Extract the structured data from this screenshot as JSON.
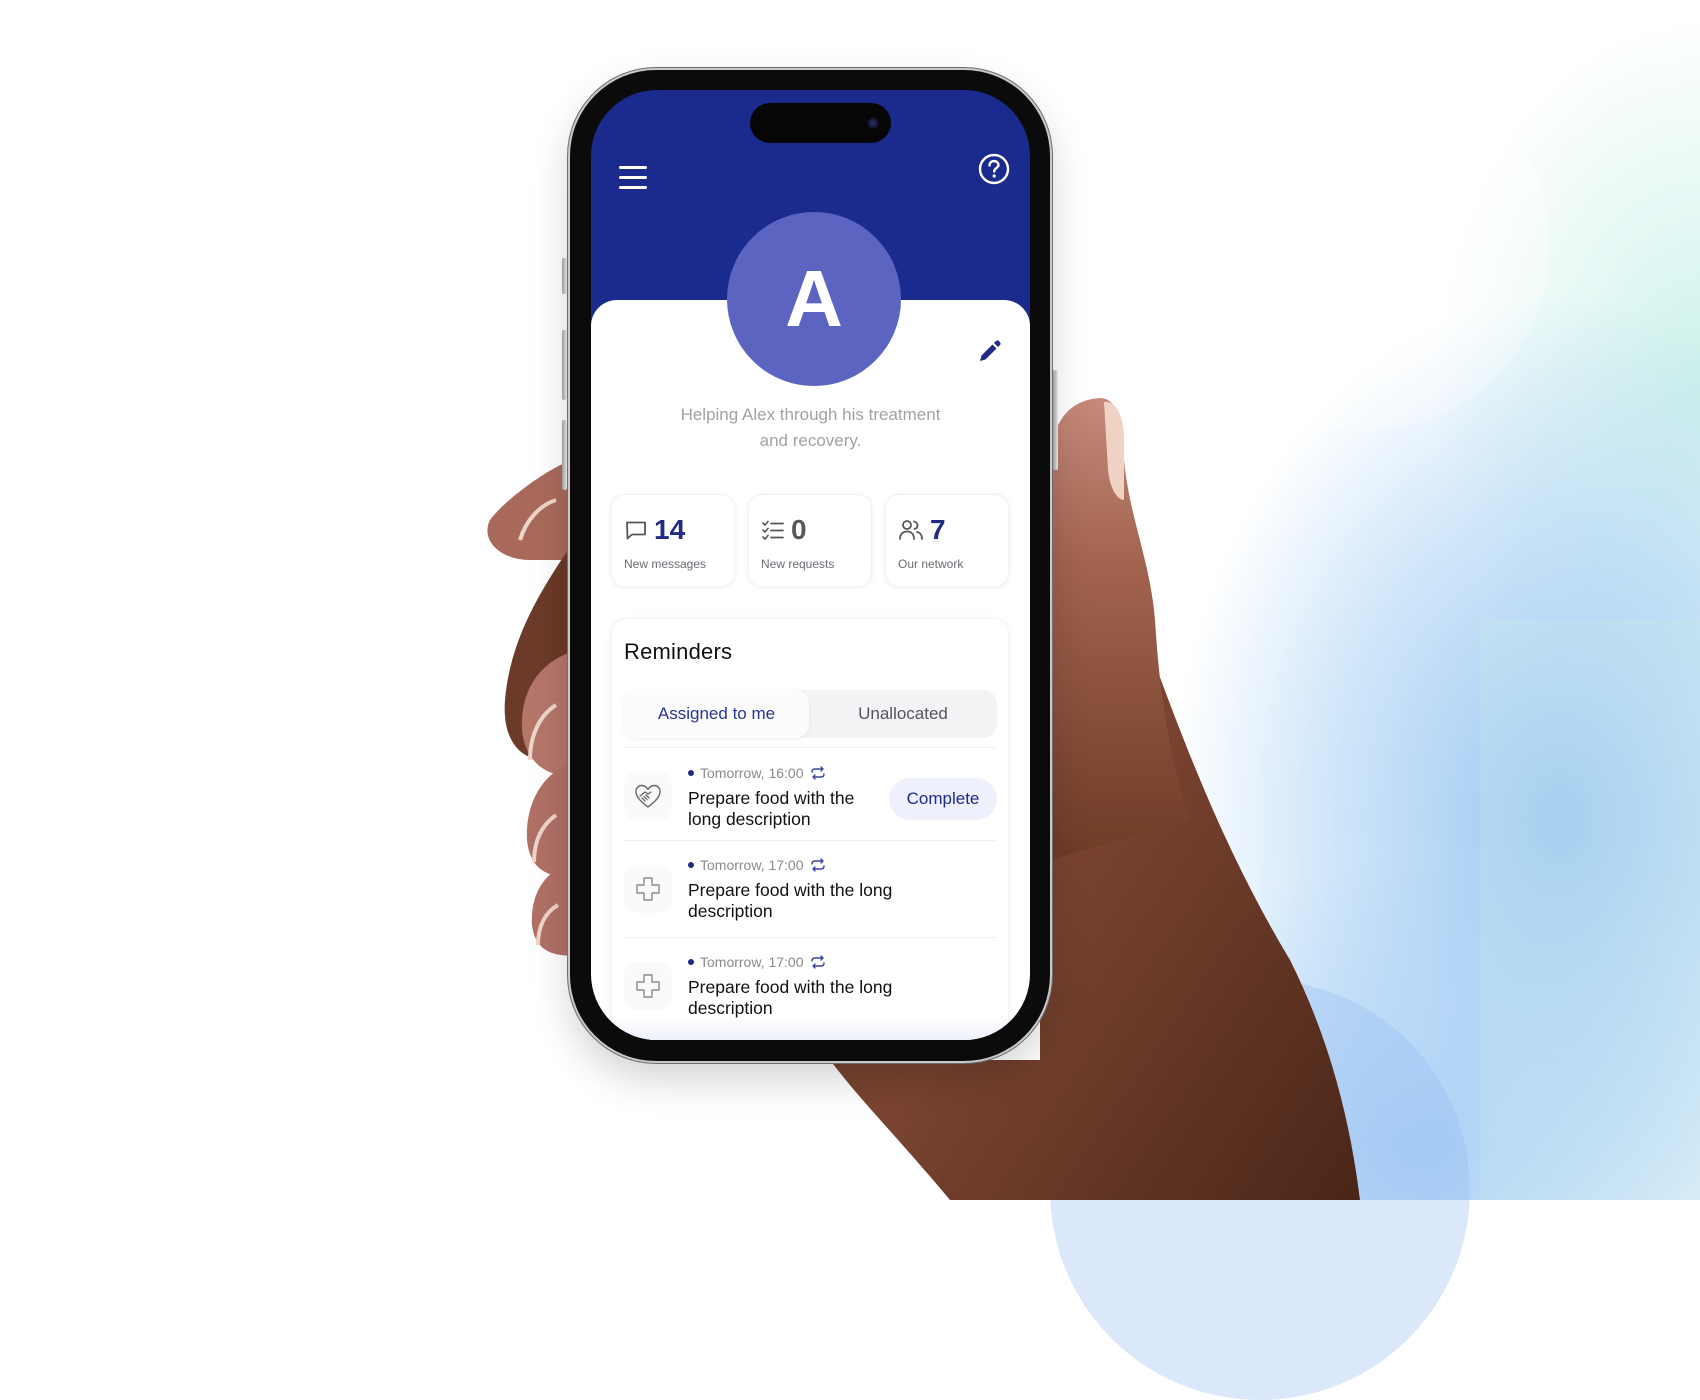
{
  "header": {
    "menu_icon": "hamburger-menu-icon",
    "help_icon": "help-circle-icon",
    "brand_color": "#1b2a8d"
  },
  "profile": {
    "avatar_initial": "A",
    "avatar_color": "#5c64c2",
    "edit_icon": "pencil-icon",
    "bio_line1": "Helping Alex through his treatment",
    "bio_line2": "and recovery."
  },
  "stats": [
    {
      "icon": "chat-bubble-icon",
      "value": "14",
      "label": "New messages"
    },
    {
      "icon": "checklist-icon",
      "value": "0",
      "label": "New requests"
    },
    {
      "icon": "users-icon",
      "value": "7",
      "label": "Our network"
    }
  ],
  "reminders": {
    "title": "Reminders",
    "tabs": [
      {
        "label": "Assigned to me",
        "active": true
      },
      {
        "label": "Unallocated",
        "active": false
      }
    ],
    "items": [
      {
        "icon": "handshake-heart-icon",
        "time": "Tomorrow, 16:00",
        "repeat_icon": "repeat-icon",
        "title_line1": "Prepare food with the",
        "title_line2": "long description",
        "action": "Complete"
      },
      {
        "icon": "medical-cross-icon",
        "time": "Tomorrow, 17:00",
        "repeat_icon": "repeat-icon",
        "title_line1": "Prepare food with the long",
        "title_line2": "description"
      },
      {
        "icon": "medical-cross-icon",
        "time": "Tomorrow, 17:00",
        "repeat_icon": "repeat-icon",
        "title_line1": "Prepare food with the long",
        "title_line2": "description"
      }
    ]
  }
}
